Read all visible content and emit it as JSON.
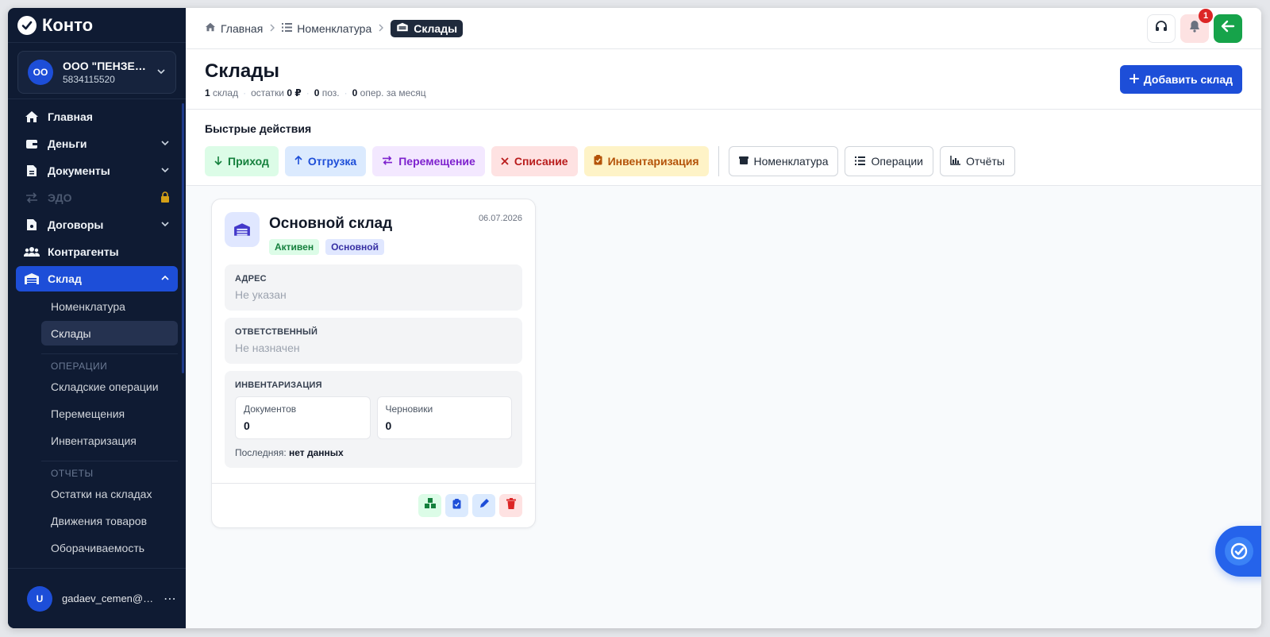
{
  "app": {
    "logo_text": "Конто"
  },
  "org": {
    "initials": "ОО",
    "name": "ООО \"ПЕНЗЕН...",
    "inn": "5834115520"
  },
  "nav": {
    "home": "Главная",
    "money": "Деньги",
    "documents": "Документы",
    "edo": "ЭДО",
    "contracts": "Договоры",
    "counterparties": "Контрагенты",
    "warehouse": "Склад",
    "sub": {
      "nomenclature": "Номенклатура",
      "warehouses": "Склады",
      "ops_head": "ОПЕРАЦИИ",
      "warehouse_ops": "Складские операции",
      "transfers": "Перемещения",
      "inventory": "Инвентаризация",
      "reports_head": "ОТЧЕТЫ",
      "stock": "Остатки на складах",
      "movements": "Движения товаров",
      "turnover": "Оборачиваемость"
    }
  },
  "user": {
    "initial": "U",
    "email": "gadaev_cemen@ra...",
    "menu": "⋯"
  },
  "breadcrumbs": {
    "home": "Главная",
    "nomenclature": "Номенклатура",
    "current": "Склады"
  },
  "notifications": {
    "count": "1"
  },
  "page": {
    "title": "Склады",
    "stats": {
      "warehouses_count": "1",
      "warehouses_label": "склад",
      "remains_label": "остатки",
      "remains_value": "0 ₽",
      "positions_count": "0",
      "positions_label": "поз.",
      "ops_count": "0",
      "ops_label": "опер. за месяц"
    },
    "add_button": "Добавить склад"
  },
  "quick_actions": {
    "title": "Быстрые действия",
    "income": "Приход",
    "shipment": "Отгрузка",
    "transfer": "Перемещение",
    "writeoff": "Списание",
    "inventory": "Инвентаризация",
    "nomenclature": "Номенклатура",
    "operations": "Операции",
    "reports": "Отчёты"
  },
  "warehouse_card": {
    "name": "Основной склад",
    "date": "06.07.2026",
    "tag_status": "Активен",
    "tag_main": "Основной",
    "address_label": "АДРЕС",
    "address_value": "Не указан",
    "responsible_label": "ОТВЕТСТВЕННЫЙ",
    "responsible_value": "Не назначен",
    "inventory_label": "ИНВЕНТАРИЗАЦИЯ",
    "docs_label": "Документов",
    "docs_value": "0",
    "drafts_label": "Черновики",
    "drafts_value": "0",
    "last_label": "Последняя:",
    "last_value": "нет данных"
  },
  "colors": {
    "sidebar": "#0f1b33",
    "accent": "#1d4ed8",
    "success": "#16a34a",
    "danger": "#dc2626"
  }
}
